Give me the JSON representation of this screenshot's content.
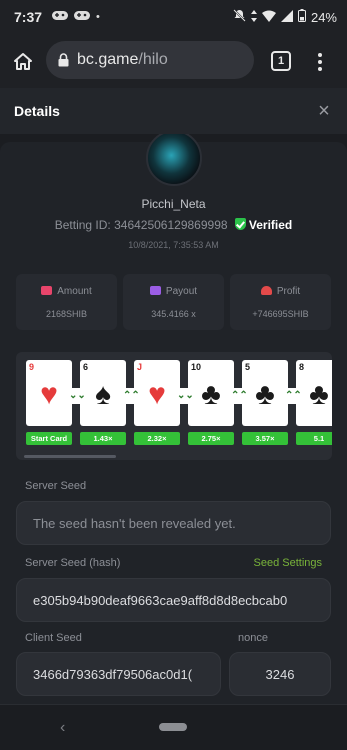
{
  "status_bar": {
    "time": "7:37",
    "battery": "24%",
    "dot": "•"
  },
  "browser": {
    "url_host": "bc.game",
    "url_path": "/hilo",
    "tab_count": "1"
  },
  "modal": {
    "title": "Details",
    "close": "×"
  },
  "player": {
    "username": "Picchi_Neta",
    "betting_id_label": "Betting ID:",
    "betting_id": "346425061298699​98",
    "verified_label": "Verified",
    "date": "10/8/2021, 7:35:53 AM"
  },
  "stats": {
    "amount": {
      "label": "Amount",
      "value": "2168SHIB",
      "icon_color": "#e8456b"
    },
    "payout": {
      "label": "Payout",
      "value": "345.4166 x",
      "icon_color": "#9b5de5"
    },
    "profit": {
      "label": "Profit",
      "value": "+746695SHIB",
      "icon_color": "#e34a4a"
    }
  },
  "cards": [
    {
      "rank": "9",
      "suit": "♥",
      "color": "red",
      "multiplier": "Start Card"
    },
    {
      "rank": "6",
      "suit": "♠",
      "color": "black",
      "multiplier": "1.43×"
    },
    {
      "rank": "J",
      "suit": "♥",
      "color": "red",
      "multiplier": "2.32×"
    },
    {
      "rank": "10",
      "suit": "♣",
      "color": "black",
      "multiplier": "2.75×"
    },
    {
      "rank": "5",
      "suit": "♣",
      "color": "black",
      "multiplier": "3.57×"
    },
    {
      "rank": "8",
      "suit": "♣",
      "color": "black",
      "multiplier": "5.1"
    }
  ],
  "chevrons": [
    "⌄⌄",
    "⌃⌃",
    "⌄⌄",
    "⌃⌃",
    "⌃⌃"
  ],
  "fields": {
    "server_seed_label": "Server Seed",
    "server_seed_value": "The seed hasn't been revealed yet.",
    "server_seed_hash_label": "Server Seed (hash)",
    "seed_settings_link": "Seed Settings",
    "server_seed_hash_value": "e305b94b90deaf9663cae9aff8d8d8ecbcab0",
    "client_seed_label": "Client Seed",
    "client_seed_value": "3466d79363df79506ac0d1(",
    "nonce_label": "nonce",
    "nonce_value": "3246"
  },
  "nav": {
    "back": "‹"
  }
}
